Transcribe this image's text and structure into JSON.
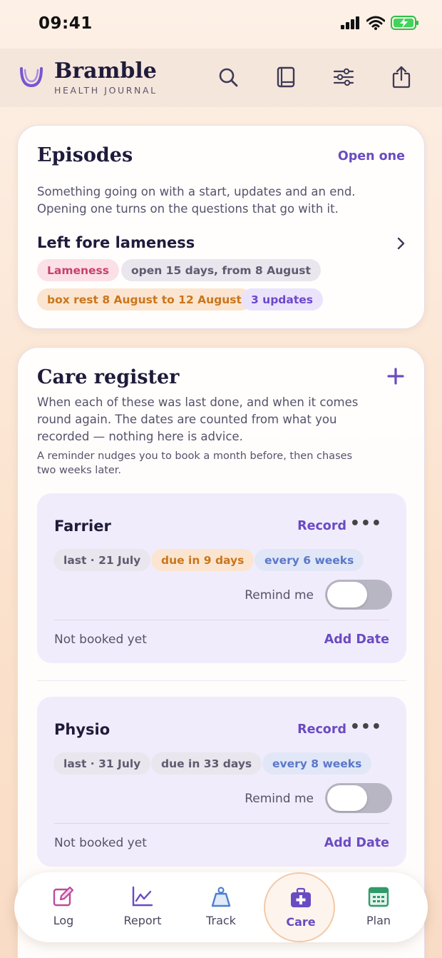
{
  "status_bar": {
    "time": "09:41"
  },
  "header": {
    "brand_name": "Bramble",
    "brand_sub": "HEALTH JOURNAL",
    "icons": [
      "search-icon",
      "journal-book-icon",
      "filter-sliders-icon",
      "share-icon"
    ]
  },
  "episodes": {
    "title": "Episodes",
    "action": "Open one",
    "description": "Something going on with a start, updates and an end. Opening one turns on the questions that go with it.",
    "episode": {
      "title": "Left fore lameness",
      "chips": [
        "Lameness",
        "open 15 days, from 8 August",
        "box rest 8 August to 12 August",
        "3 updates"
      ]
    }
  },
  "care_register": {
    "title": "Care register",
    "description": "When each of these was last done, and when it comes round again. The dates are counted from what you recorded — nothing here is advice.",
    "note": "A reminder nudges you to book a month before, then chases two weeks later.",
    "items": [
      {
        "name": "Farrier",
        "record_label": "Record",
        "last": "last · 21 July",
        "due": "due in 9 days",
        "every": "every 6 weeks",
        "remind_label": "Remind me",
        "remind_on": false,
        "booking_status": "Not booked yet",
        "add_date_label": "Add Date"
      },
      {
        "name": "Physio",
        "record_label": "Record",
        "last": "last · 31 July",
        "due": "due in 33 days",
        "every": "every 8 weeks",
        "remind_label": "Remind me",
        "remind_on": false,
        "booking_status": "Not booked yet",
        "add_date_label": "Add Date"
      }
    ]
  },
  "nav": {
    "items": [
      {
        "label": "Log",
        "icon": "pencil-square-icon"
      },
      {
        "label": "Report",
        "icon": "chart-line-icon"
      },
      {
        "label": "Track",
        "icon": "weight-icon"
      },
      {
        "label": "Care",
        "icon": "first-aid-kit-icon",
        "active": true
      },
      {
        "label": "Plan",
        "icon": "calendar-icon"
      }
    ]
  },
  "colors": {
    "accent": "#6a4bc2",
    "background": "#fbe2cd"
  }
}
